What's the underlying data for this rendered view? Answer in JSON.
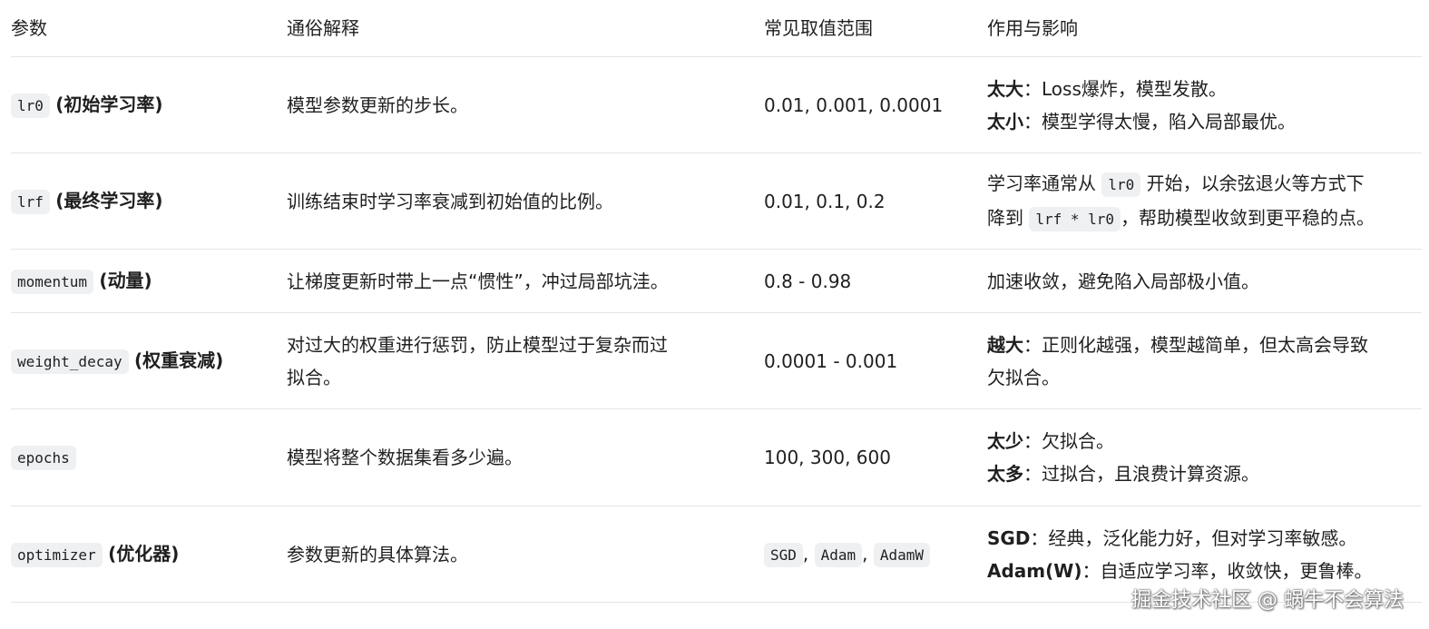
{
  "headers": [
    "参数",
    "通俗解释",
    "常见取值范围",
    "作用与影响"
  ],
  "rows": [
    {
      "param_code": "lr0",
      "param_label": "(初始学习率)",
      "desc": "模型参数更新的步长。",
      "range": "0.01, 0.001, 0.0001",
      "effect1_bold": "太大",
      "effect1_text": "：Loss爆炸，模型发散。",
      "effect2_bold": "太小",
      "effect2_text": "：模型学得太慢，陷入局部最优。"
    },
    {
      "param_code": "lrf",
      "param_label": "(最终学习率)",
      "desc": "训练结束时学习率衰减到初始值的比例。",
      "range": "0.01, 0.1, 0.2",
      "effect_a": "学习率通常从 ",
      "effect_code1": "lr0",
      "effect_b": " 开始，以余弦退火等方式下",
      "effect_c": "降到 ",
      "effect_code2": "lrf * lr0",
      "effect_d": "，帮助模型收敛到更平稳的点。"
    },
    {
      "param_code": "momentum",
      "param_label": "(动量)",
      "desc": "让梯度更新时带上一点“惯性”，冲过局部坑洼。",
      "range": "0.8 - 0.98",
      "effect": "加速收敛，避免陷入局部极小值。"
    },
    {
      "param_code": "weight_decay",
      "param_label": "(权重衰减)",
      "desc1": "对过大的权重进行惩罚，防止模型过于复杂而过",
      "desc2": "拟合。",
      "range": "0.0001 - 0.001",
      "effect_bold": "越大",
      "effect1": "：正则化越强，模型越简单，但太高会导致",
      "effect2": "欠拟合。"
    },
    {
      "param_code": "epochs",
      "desc": "模型将整个数据集看多少遍。",
      "range": "100, 300, 600",
      "effect1_bold": "太少",
      "effect1_text": "：欠拟合。",
      "effect2_bold": "太多",
      "effect2_text": "：过拟合，且浪费计算资源。"
    },
    {
      "param_code": "optimizer",
      "param_label": "(优化器)",
      "desc": "参数更新的具体算法。",
      "range_codes": [
        "SGD",
        "Adam",
        "AdamW"
      ],
      "range_sep": ",",
      "effect1_bold": "SGD",
      "effect1_text": "：经典，泛化能力好，但对学习率敏感。",
      "effect2_bold": "Adam(W)",
      "effect2_text": "：自适应学习率，收敛快，更鲁棒。"
    }
  ],
  "watermark": "掘金技术社区 @ 蜗牛不会算法"
}
